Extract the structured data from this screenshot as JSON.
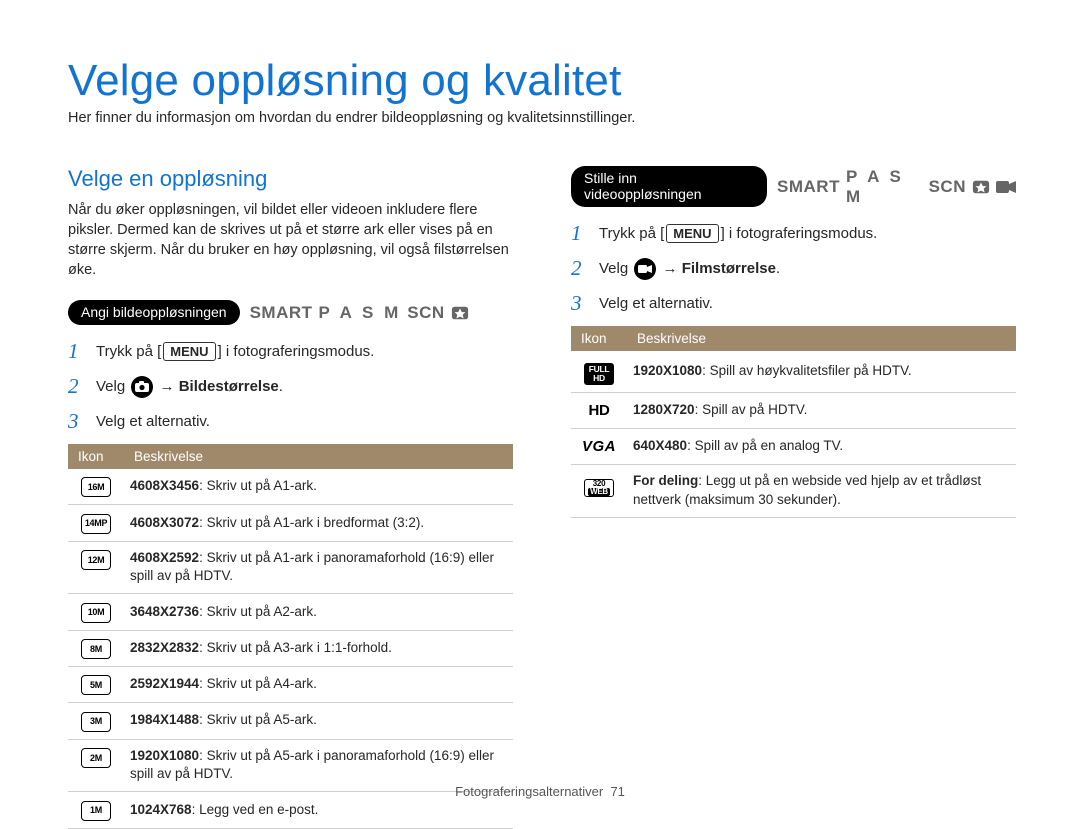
{
  "title": "Velge oppløsning og kvalitet",
  "intro": "Her finner du informasjon om hvordan du endrer bildeoppløsning og kvalitetsinnstillinger.",
  "left": {
    "subtitle": "Velge en oppløsning",
    "subintro": "Når du øker oppløsningen, vil bildet eller videoen inkludere flere piksler. Dermed kan de skrives ut på et større ark eller vises på en større skjerm. Når du bruker en høy oppløsning, vil også filstørrelsen øke.",
    "pill": "Angi bildeoppløsningen",
    "modes": {
      "smart": "SMART",
      "pasm": "P A S M",
      "scn": "SCN"
    },
    "steps": {
      "s1a": "Trykk på [",
      "s1_menu": "MENU",
      "s1b": "] i fotograferingsmodus.",
      "s2a": "Velg ",
      "s2b": " → ",
      "s2c": "Bildestørrelse",
      "s2d": ".",
      "s3": "Velg et alternativ."
    },
    "thead": {
      "icon": "Ikon",
      "desc": "Beskrivelse"
    },
    "rows": [
      {
        "badge": "16M",
        "bold": "4608X3456",
        "desc": ": Skriv ut på A1-ark."
      },
      {
        "badge": "14MP",
        "bold": "4608X3072",
        "desc": ": Skriv ut på A1-ark i bredformat (3:2)."
      },
      {
        "badge": "12M",
        "bold": "4608X2592",
        "desc": ": Skriv ut på A1-ark i panoramaforhold (16:9) eller spill av på HDTV."
      },
      {
        "badge": "10M",
        "bold": "3648X2736",
        "desc": ": Skriv ut på A2-ark."
      },
      {
        "badge": "8M",
        "bold": "2832X2832",
        "desc": ": Skriv ut på A3-ark i 1:1-forhold."
      },
      {
        "badge": "5M",
        "bold": "2592X1944",
        "desc": ": Skriv ut på A4-ark."
      },
      {
        "badge": "3M",
        "bold": "1984X1488",
        "desc": ": Skriv ut på A5-ark."
      },
      {
        "badge": "2M",
        "bold": "1920X1080",
        "desc": ": Skriv ut på A5-ark i panoramaforhold (16:9) eller spill av på HDTV."
      },
      {
        "badge": "1M",
        "bold": "1024X768",
        "desc": ": Legg ved en e-post."
      }
    ]
  },
  "right": {
    "pill": "Stille inn videooppløsningen",
    "modes": {
      "smart": "SMART",
      "pasm": "P A S M",
      "scn": "SCN"
    },
    "steps": {
      "s1a": "Trykk på [",
      "s1_menu": "MENU",
      "s1b": "] i fotograferingsmodus.",
      "s2a": "Velg ",
      "s2b": " → ",
      "s2c": "Filmstørrelse",
      "s2d": ".",
      "s3": "Velg et alternativ."
    },
    "thead": {
      "icon": "Ikon",
      "desc": "Beskrivelse"
    },
    "rows": [
      {
        "badge_type": "fullhd",
        "bold": "1920X1080",
        "desc": ": Spill av høykvalitetsfiler på HDTV."
      },
      {
        "badge_type": "hd",
        "bold": "1280X720",
        "desc": ": Spill av på HDTV."
      },
      {
        "badge_type": "vga",
        "bold": "640X480",
        "desc": ": Spill av på en analog TV."
      },
      {
        "badge_type": "web",
        "bold": "For deling",
        "desc": ": Legg ut på en webside ved hjelp av et trådløst nettverk (maksimum 30 sekunder)."
      }
    ]
  },
  "footer": {
    "label": "Fotograferingsalternativer",
    "page": "71"
  }
}
